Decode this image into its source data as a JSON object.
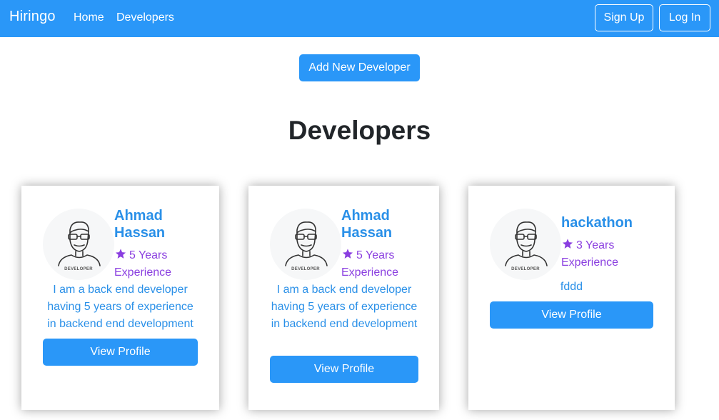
{
  "navbar": {
    "brand": "Hiringo",
    "links": [
      "Home",
      "Developers"
    ],
    "signup_label": "Sign Up",
    "login_label": "Log In"
  },
  "main": {
    "add_button_label": "Add New Developer",
    "title": "Developers"
  },
  "avatar_caption": "DEVELOPER",
  "developers": [
    {
      "name": "Ahmad Hassan",
      "experience": "5 Years Experience",
      "description": "I am a back end developer having 5 years of experience in backend end development",
      "button_label": "View Profile"
    },
    {
      "name": "Ahmad Hassan",
      "experience": "5 Years Experience",
      "description": "I am a back end developer having 5 years of experience in backend end development",
      "button_label": "View Profile"
    },
    {
      "name": "hackathon",
      "experience": "3 Years Experience",
      "description": "fddd",
      "button_label": "View Profile"
    }
  ],
  "colors": {
    "primary": "#2a97f8",
    "name_text": "#2a90e8",
    "experience_text": "#8a3ee0"
  },
  "icons": {
    "avatar": "developer-avatar-icon",
    "experience": "star-icon"
  }
}
